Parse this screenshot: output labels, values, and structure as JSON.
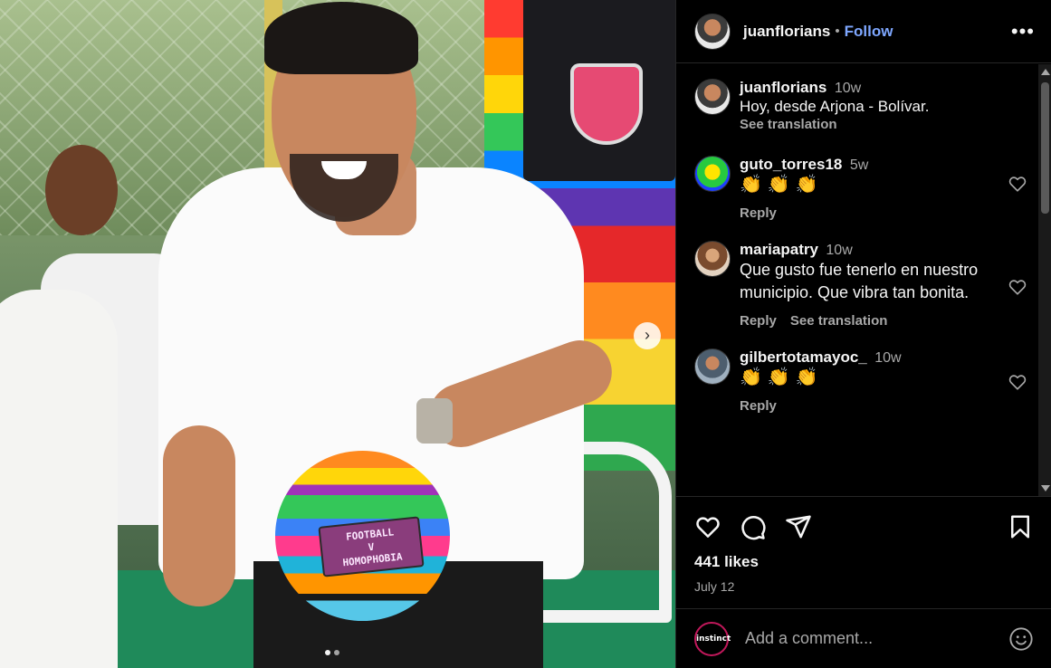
{
  "post": {
    "author": "juanflorians",
    "follow_label": "Follow",
    "separator": "•",
    "more_icon": "more-horizontal-icon"
  },
  "photo": {
    "ball_text": "FOOTBALL\nV\nHOMOPHOBIA",
    "next_icon": "chevron-right-icon",
    "slides": 2,
    "active_slide": 1
  },
  "caption": {
    "user": "juanflorians",
    "time": "10w",
    "text": "Hoy, desde Arjona - Bolívar.",
    "see_translation": "See translation"
  },
  "comments": [
    {
      "user": "guto_torres18",
      "time": "5w",
      "text": "👏👏👏",
      "reply": "Reply"
    },
    {
      "user": "mariapatry",
      "time": "10w",
      "text": "Que gusto fue tenerlo en nuestro municipio. Que vibra tan bonita.",
      "reply": "Reply",
      "see_translation": "See translation"
    },
    {
      "user": "gilbertotamayoc_",
      "time": "10w",
      "text": "👏👏👏",
      "reply": "Reply"
    }
  ],
  "actions": {
    "like_icon": "heart-icon",
    "comment_icon": "comment-icon",
    "share_icon": "send-icon",
    "save_icon": "bookmark-icon"
  },
  "likes": "441 likes",
  "date": "July 12",
  "add_comment": {
    "avatar_text": "instinct",
    "placeholder": "Add a comment...",
    "emoji_icon": "smiley-icon"
  },
  "colors": {
    "background": "#000000",
    "follow": "#7ea7ff",
    "muted": "#a8a8a8",
    "border": "#262626"
  }
}
